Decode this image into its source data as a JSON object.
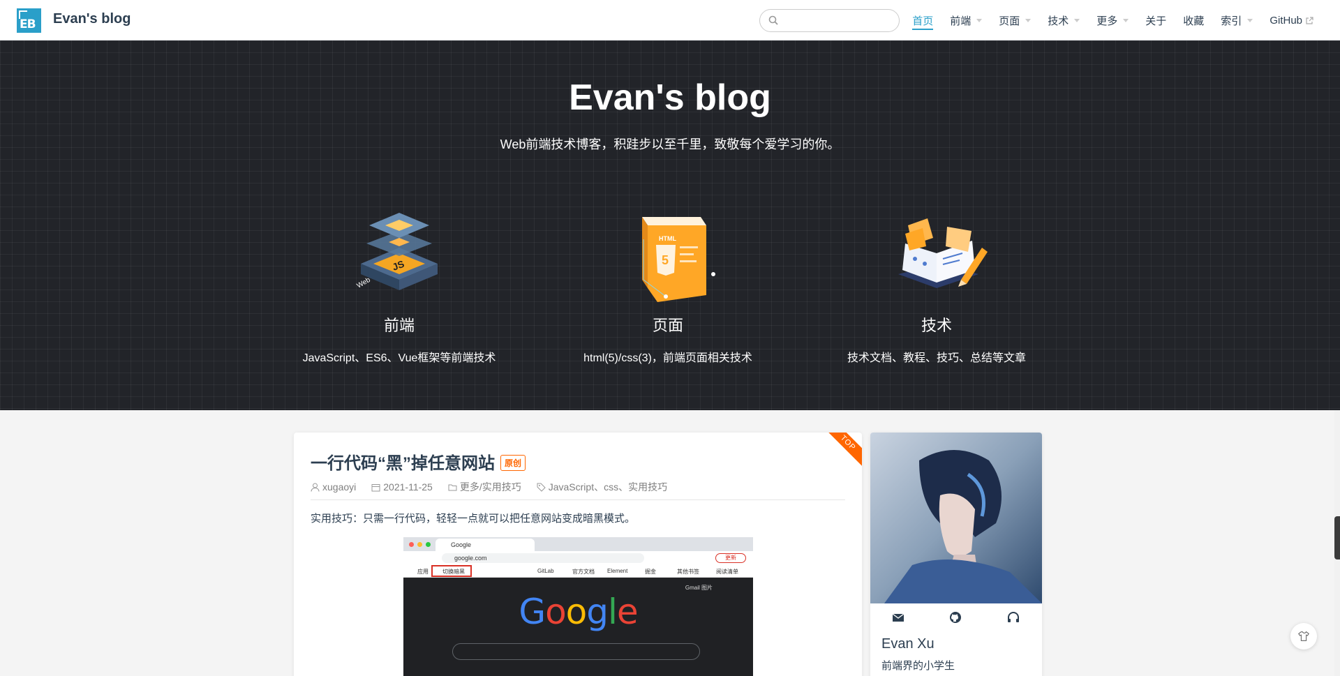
{
  "site": {
    "logo": "EB",
    "name": "Evan's blog"
  },
  "search": {
    "placeholder": ""
  },
  "nav": [
    {
      "label": "首页",
      "dropdown": false,
      "active": true
    },
    {
      "label": "前端",
      "dropdown": true
    },
    {
      "label": "页面",
      "dropdown": true
    },
    {
      "label": "技术",
      "dropdown": true
    },
    {
      "label": "更多",
      "dropdown": true
    },
    {
      "label": "关于",
      "dropdown": false
    },
    {
      "label": "收藏",
      "dropdown": false
    },
    {
      "label": "索引",
      "dropdown": true
    },
    {
      "label": "GitHub",
      "dropdown": false,
      "external": true
    }
  ],
  "hero": {
    "title": "Evan's blog",
    "description": "Web前端技术博客，积跬步以至千里，致敬每个爱学习的你。",
    "features": [
      {
        "title": "前端",
        "desc": "JavaScript、ES6、Vue框架等前端技术",
        "icon": "js-layers-icon"
      },
      {
        "title": "页面",
        "desc": "html(5)/css(3)，前端页面相关技术",
        "icon": "html5-icon"
      },
      {
        "title": "技术",
        "desc": "技术文档、教程、技巧、总结等文章",
        "icon": "book-pencil-icon"
      }
    ]
  },
  "post": {
    "ribbon": "TOP",
    "title": "一行代码“黑”掉任意网站",
    "badge": "原创",
    "author": "xugaoyi",
    "date": "2021-11-25",
    "category": "更多/实用技巧",
    "tags": "JavaScript、css、实用技巧",
    "summary": "实用技巧：只需一行代码，轻轻一点就可以把任意网站变成暗黑模式。",
    "image": {
      "tab_title": "Google",
      "url": "google.com",
      "update_label": "更新",
      "bookmarks": [
        "应用",
        "切换暗黑",
        "GitLab",
        "官方文档",
        "Element",
        "掘金",
        "其他书签",
        "阅读清单"
      ],
      "top_links": "Gmail  图片",
      "logo": "Google"
    }
  },
  "profile": {
    "name": "Evan Xu",
    "title": "前端界的小学生",
    "social_icons": [
      "mail-icon",
      "github-icon",
      "headphones-icon"
    ]
  },
  "colors": {
    "accent": "#2a9fc9",
    "hero_bg": "#222429",
    "badge": "#ff6600"
  }
}
